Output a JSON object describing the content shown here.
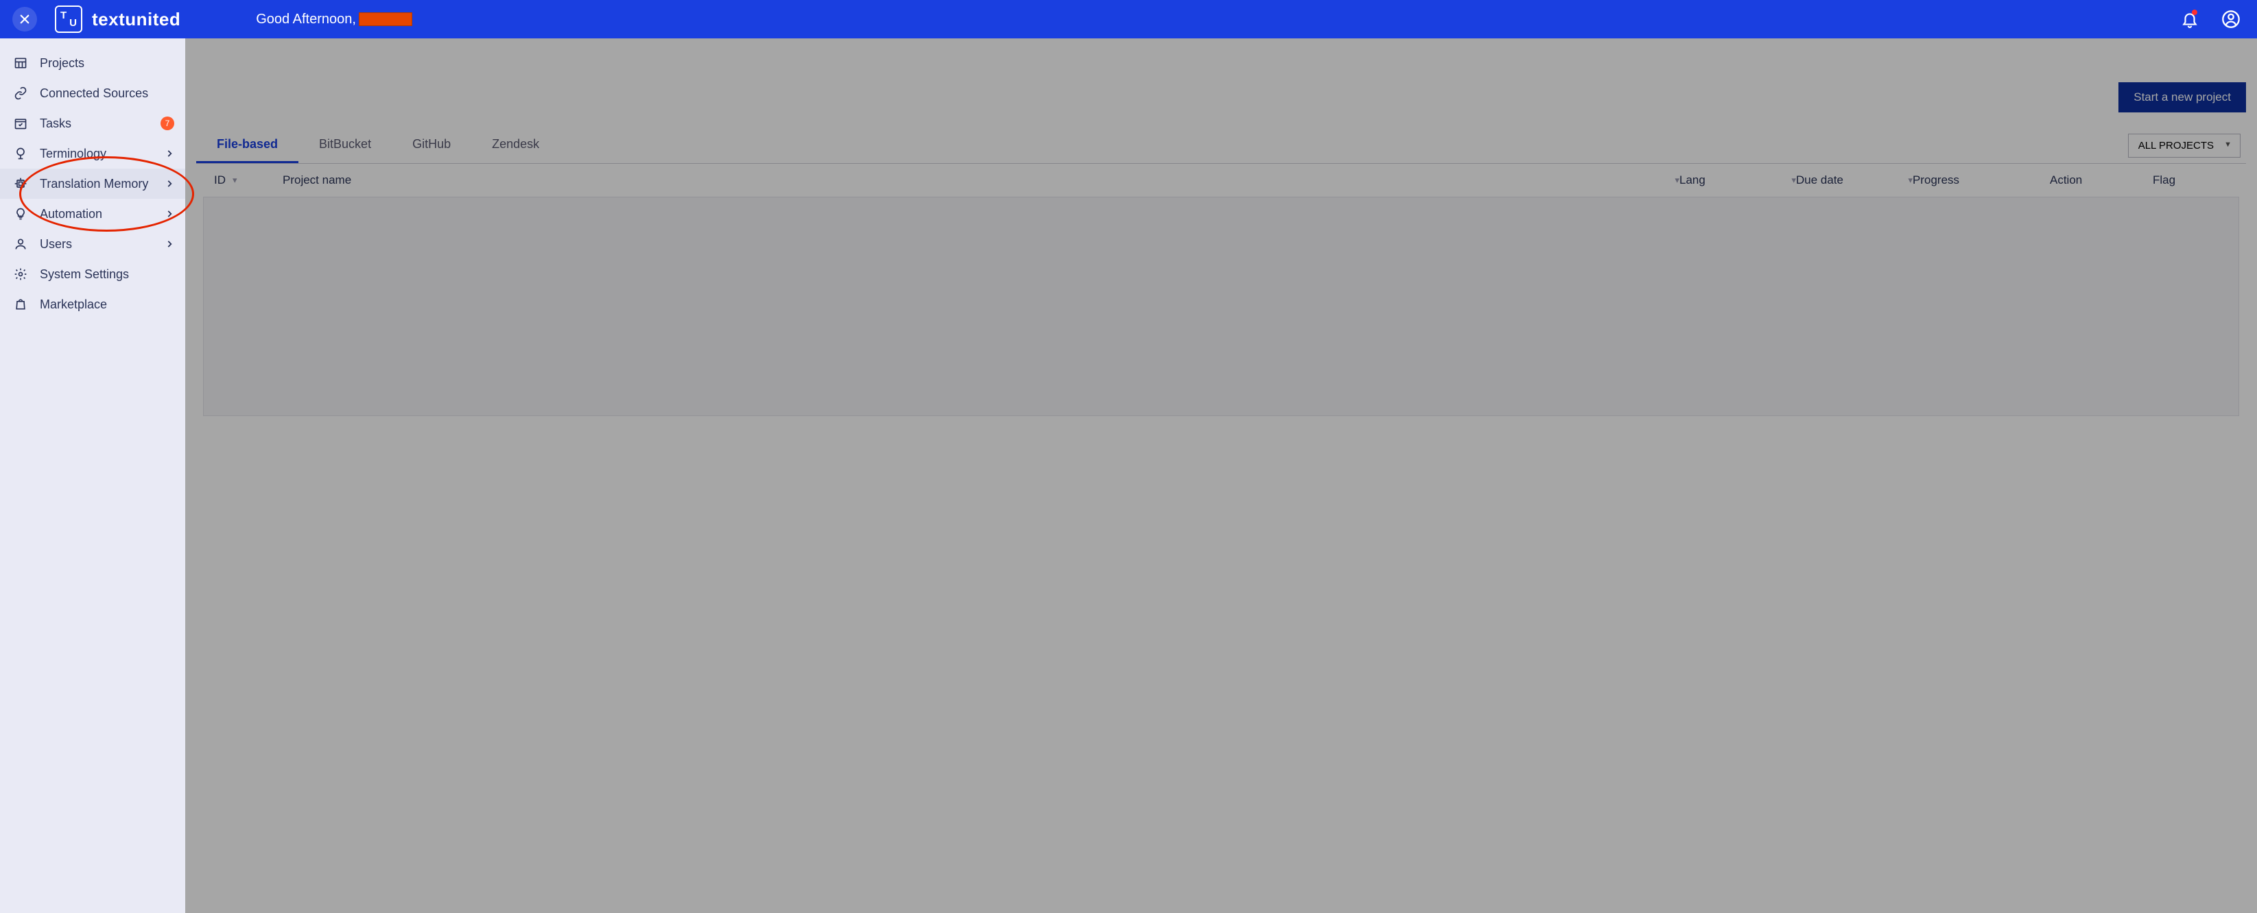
{
  "topbar": {
    "brand": "textunited",
    "greeting_prefix": "Good Afternoon,"
  },
  "sidebar": {
    "items": [
      {
        "label": "Projects",
        "icon": "grid",
        "chevron": false,
        "badge": null
      },
      {
        "label": "Connected Sources",
        "icon": "link",
        "chevron": false,
        "badge": null
      },
      {
        "label": "Tasks",
        "icon": "calendar",
        "chevron": false,
        "badge": "7"
      },
      {
        "label": "Terminology",
        "icon": "globe",
        "chevron": true,
        "badge": null
      },
      {
        "label": "Translation Memory",
        "icon": "chip",
        "chevron": true,
        "badge": null,
        "hover": true
      },
      {
        "label": "Automation",
        "icon": "bulb",
        "chevron": true,
        "badge": null
      },
      {
        "label": "Users",
        "icon": "user",
        "chevron": true,
        "badge": null
      },
      {
        "label": "System Settings",
        "icon": "gear",
        "chevron": false,
        "badge": null
      },
      {
        "label": "Marketplace",
        "icon": "bag",
        "chevron": false,
        "badge": null
      }
    ]
  },
  "main": {
    "new_project_btn": "Start a new project",
    "tabs": [
      {
        "label": "File-based",
        "active": true
      },
      {
        "label": "BitBucket",
        "active": false
      },
      {
        "label": "GitHub",
        "active": false
      },
      {
        "label": "Zendesk",
        "active": false
      }
    ],
    "project_filter": "ALL PROJECTS",
    "columns": [
      "ID",
      "Project name",
      "Lang",
      "Due date",
      "Progress",
      "Action",
      "Flag"
    ]
  }
}
